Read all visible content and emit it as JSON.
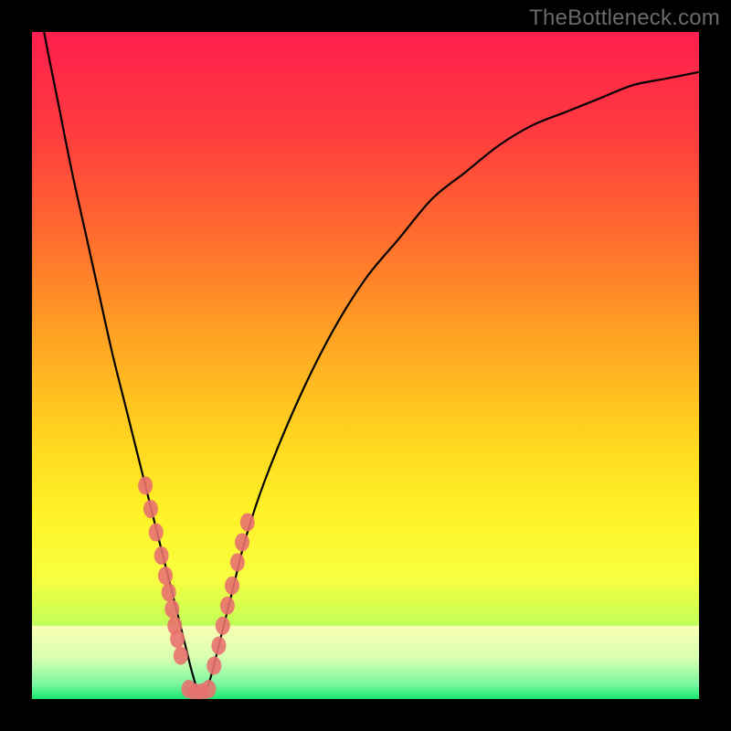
{
  "watermark": "TheBottleneck.com",
  "chart_data": {
    "type": "line",
    "title": "",
    "xlabel": "",
    "ylabel": "",
    "xlim": [
      0,
      100
    ],
    "ylim": [
      0,
      100
    ],
    "grid": false,
    "series": [
      {
        "name": "bottleneck-curve",
        "x": [
          0,
          2,
          4,
          6,
          8,
          10,
          12,
          14,
          16,
          18,
          20,
          21,
          22,
          23,
          24,
          25,
          26,
          27,
          28,
          30,
          32,
          35,
          40,
          45,
          50,
          55,
          60,
          65,
          70,
          75,
          80,
          85,
          90,
          95,
          100
        ],
        "values": [
          110,
          99,
          89,
          79,
          70,
          61,
          52,
          44,
          36,
          28,
          20,
          16,
          12,
          8,
          4,
          1,
          1,
          4,
          8,
          16,
          24,
          33,
          45,
          55,
          63,
          69,
          75,
          79,
          83,
          86,
          88,
          90,
          92,
          93,
          94
        ]
      }
    ],
    "markers": {
      "name": "marker-dots",
      "x": [
        17.0,
        17.8,
        18.6,
        19.4,
        20.0,
        20.5,
        21.0,
        21.4,
        21.8,
        22.3,
        23.5,
        24.5,
        25.5,
        26.5,
        27.3,
        28.0,
        28.6,
        29.3,
        30.0,
        30.8,
        31.5,
        32.3
      ],
      "values": [
        32,
        28.5,
        25,
        21.5,
        18.5,
        16,
        13.5,
        11,
        9,
        6.5,
        1.5,
        1,
        1,
        1.5,
        5,
        8,
        11,
        14,
        17,
        20.5,
        23.5,
        26.5
      ]
    },
    "gradient_stops": [
      {
        "offset": 0.0,
        "color": "#ff1f4d"
      },
      {
        "offset": 0.15,
        "color": "#ff3b3f"
      },
      {
        "offset": 0.3,
        "color": "#ff6a2f"
      },
      {
        "offset": 0.45,
        "color": "#ffa023"
      },
      {
        "offset": 0.6,
        "color": "#ffd21f"
      },
      {
        "offset": 0.72,
        "color": "#fff227"
      },
      {
        "offset": 0.82,
        "color": "#f7ff40"
      },
      {
        "offset": 0.88,
        "color": "#c9ff55"
      },
      {
        "offset": 0.93,
        "color": "#7eff6a"
      },
      {
        "offset": 1.0,
        "color": "#17e86f"
      }
    ],
    "bottom_band": {
      "from_y": 11,
      "to_y": 0,
      "stops": [
        {
          "offset": 0.0,
          "color": "#fbffb4"
        },
        {
          "offset": 0.45,
          "color": "#d7ffb0"
        },
        {
          "offset": 0.8,
          "color": "#78f7a0"
        },
        {
          "offset": 1.0,
          "color": "#17e86f"
        }
      ]
    }
  }
}
